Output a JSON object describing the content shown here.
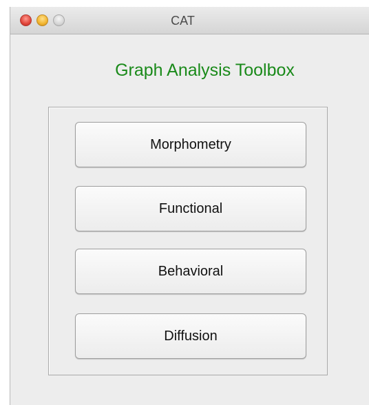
{
  "window": {
    "title": "CAT"
  },
  "app": {
    "title": "Graph Analysis Toolbox"
  },
  "buttons": [
    {
      "label": "Morphometry"
    },
    {
      "label": "Functional"
    },
    {
      "label": "Behavioral"
    },
    {
      "label": "Diffusion"
    }
  ],
  "colors": {
    "title_green": "#1a8a1a",
    "background": "#ededed"
  },
  "icons": [
    "close-icon",
    "minimize-icon",
    "zoom-icon"
  ]
}
